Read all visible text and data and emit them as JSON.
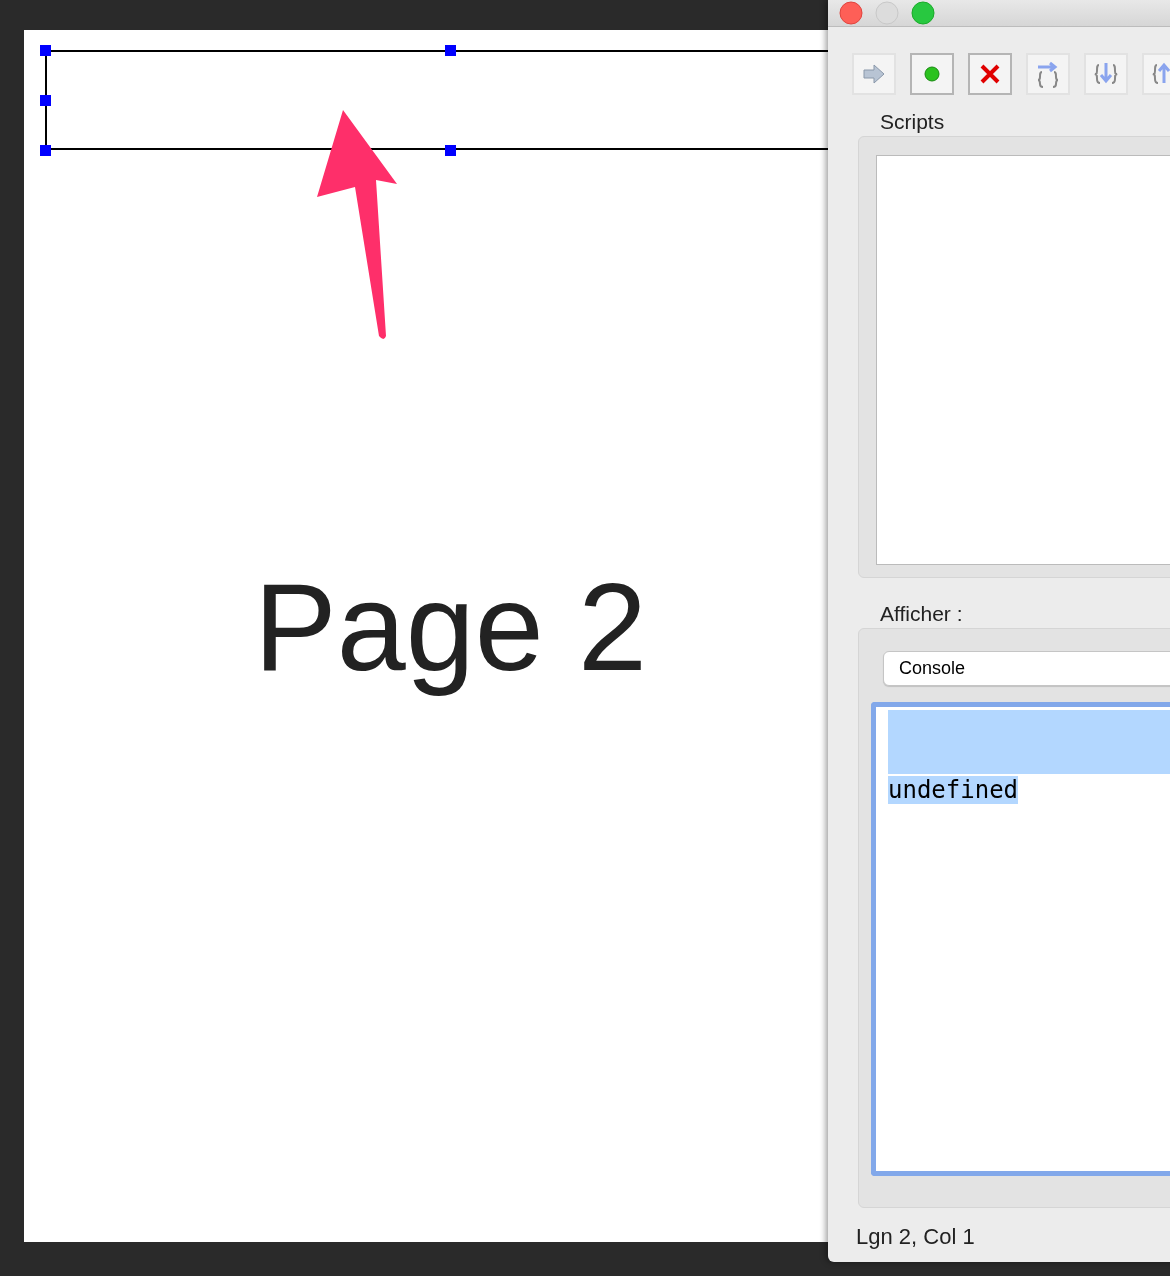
{
  "document": {
    "page_label": "Page 2",
    "selected_frame": true
  },
  "script_window": {
    "scripts_label": "Scripts",
    "display_label": "Afficher :",
    "display_select": {
      "value": "Console"
    },
    "console": {
      "selected": true,
      "lines": [
        "undefined"
      ]
    },
    "status_bar": "Lgn 2, Col 1"
  }
}
